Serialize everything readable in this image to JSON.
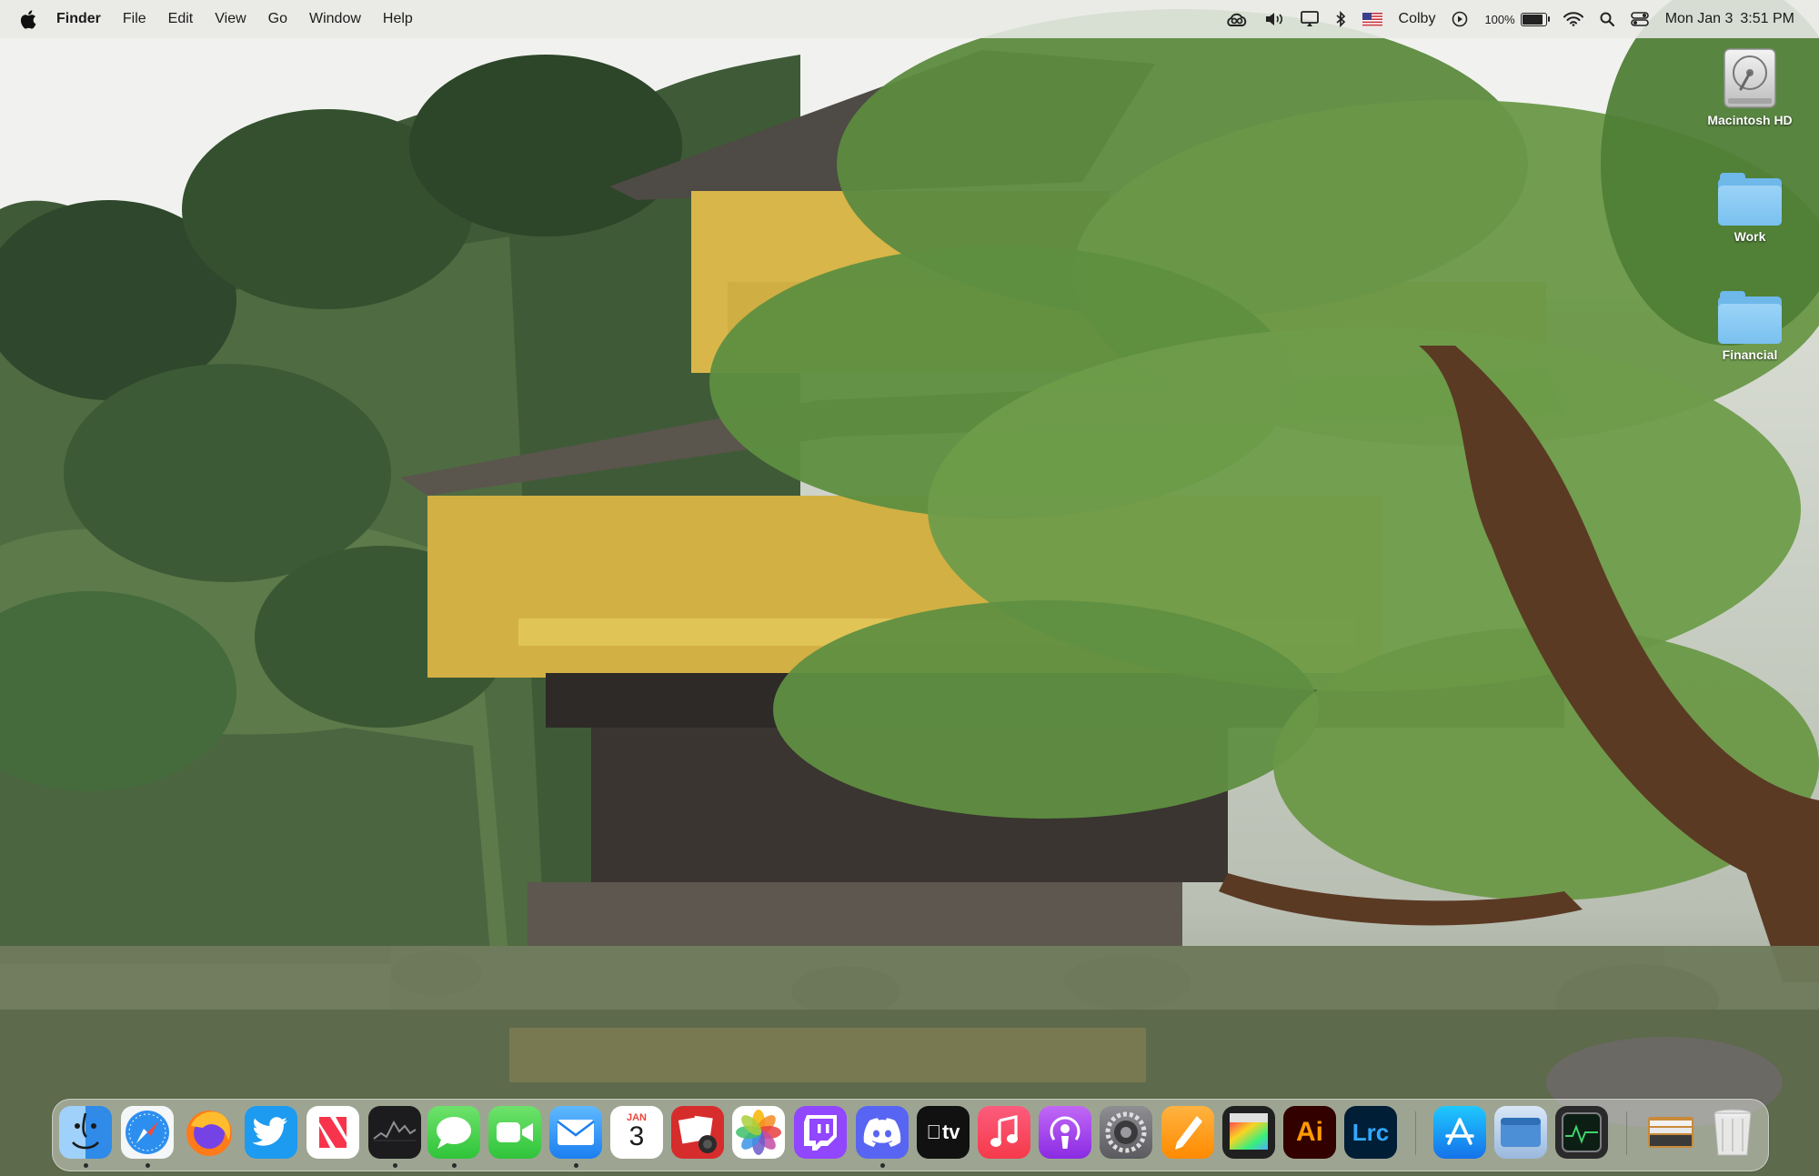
{
  "menubar": {
    "apple_icon": "apple-logo",
    "app_name": "Finder",
    "menus": [
      "File",
      "Edit",
      "View",
      "Go",
      "Window",
      "Help"
    ],
    "status": {
      "user_name": "Colby",
      "battery_percent": "100%",
      "battery_level": 1.0,
      "date": "Mon Jan 3",
      "time": "3:51 PM"
    }
  },
  "desktop": {
    "items": [
      {
        "label": "Macintosh HD",
        "icon": "hard-drive-icon"
      },
      {
        "label": "Work",
        "icon": "folder-icon"
      },
      {
        "label": "Financial",
        "icon": "folder-icon"
      }
    ]
  },
  "dock": {
    "calendar": {
      "month": "JAN",
      "day": "3"
    },
    "apps": [
      {
        "name": "finder",
        "running": true
      },
      {
        "name": "safari",
        "running": true
      },
      {
        "name": "firefox",
        "running": false
      },
      {
        "name": "twitter",
        "running": false
      },
      {
        "name": "news",
        "running": false
      },
      {
        "name": "stocks",
        "running": true
      },
      {
        "name": "messages",
        "running": true
      },
      {
        "name": "facetime",
        "running": false
      },
      {
        "name": "mail",
        "running": true
      },
      {
        "name": "calendar",
        "running": false
      },
      {
        "name": "photo-booth",
        "running": false
      },
      {
        "name": "photos",
        "running": false
      },
      {
        "name": "twitch",
        "running": false
      },
      {
        "name": "discord",
        "running": true
      },
      {
        "name": "apple-tv",
        "running": false
      },
      {
        "name": "music",
        "running": false
      },
      {
        "name": "podcasts",
        "running": false
      },
      {
        "name": "system-preferences",
        "running": false
      },
      {
        "name": "pages",
        "running": false
      },
      {
        "name": "final-cut-pro",
        "running": false
      },
      {
        "name": "illustrator",
        "running": false
      },
      {
        "name": "lightroom-classic",
        "running": false
      },
      {
        "name": "app-store",
        "running": false
      },
      {
        "name": "window-app",
        "running": false
      },
      {
        "name": "activity-monitor",
        "running": false
      },
      {
        "name": "stacks-folder",
        "running": false
      },
      {
        "name": "trash",
        "running": false
      }
    ],
    "labels": {
      "tv": "tv",
      "illustrator": "Ai",
      "lightroom": "Lrc"
    }
  }
}
